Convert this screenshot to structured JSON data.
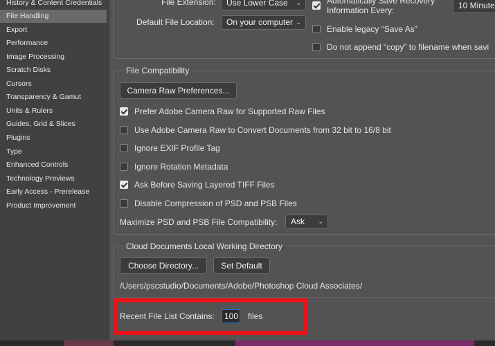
{
  "sidebar": {
    "items": [
      {
        "label": "History & Content Credentials"
      },
      {
        "label": "File Handling",
        "selected": true
      },
      {
        "label": "Export"
      },
      {
        "label": "Performance"
      },
      {
        "label": "Image Processing"
      },
      {
        "label": "Scratch Disks"
      },
      {
        "label": "Cursors"
      },
      {
        "label": "Transparency & Gamut"
      },
      {
        "label": "Units & Rulers"
      },
      {
        "label": "Guides, Grid & Slices"
      },
      {
        "label": "Plugins"
      },
      {
        "label": "Type"
      },
      {
        "label": "Enhanced Controls"
      },
      {
        "label": "Technology Previews"
      },
      {
        "label": "Early Access - Prerelease"
      },
      {
        "label": "Product Improvement"
      }
    ]
  },
  "file_saving": {
    "file_extension_label": "File Extension:",
    "file_extension_value": "Use Lower Case",
    "default_location_label": "Default File Location:",
    "default_location_value": "On your computer",
    "auto_save_label_1": "Automatically Save Recovery",
    "auto_save_label_2": "Information Every:",
    "auto_save_value": "10 Minute",
    "auto_save_checked": true,
    "legacy_save_as_label": "Enable legacy “Save As”",
    "legacy_save_as_checked": false,
    "no_copy_label": "Do not append “copy” to filename when savi",
    "no_copy_checked": false
  },
  "file_compatibility": {
    "title": "File Compatibility",
    "camera_raw_button": "Camera Raw Preferences...",
    "options": [
      {
        "label": "Prefer Adobe Camera Raw for Supported Raw Files",
        "checked": true
      },
      {
        "label": "Use Adobe Camera Raw to Convert Documents from 32 bit to 16/8 bit",
        "checked": false
      },
      {
        "label": "Ignore EXIF Profile Tag",
        "checked": false
      },
      {
        "label": "Ignore Rotation Metadata",
        "checked": false
      },
      {
        "label": "Ask Before Saving Layered TIFF Files",
        "checked": true
      },
      {
        "label": "Disable Compression of PSD and PSB Files",
        "checked": false
      }
    ],
    "maximize_label": "Maximize PSD and PSB File Compatibility:",
    "maximize_value": "Ask"
  },
  "cloud_documents": {
    "title": "Cloud Documents Local Working Directory",
    "choose_button": "Choose Directory...",
    "default_button": "Set Default",
    "path": "/Users/pscstudio/Documents/Adobe/Photoshop Cloud Associates/"
  },
  "recent_files": {
    "label": "Recent File List Contains:",
    "value": "100",
    "suffix": "files"
  },
  "colors": {
    "background": "#535353",
    "sidebar": "#414141",
    "selected": "#6a6a6a",
    "highlight": "#e8141a",
    "input_focus": "#1d6ee0"
  }
}
